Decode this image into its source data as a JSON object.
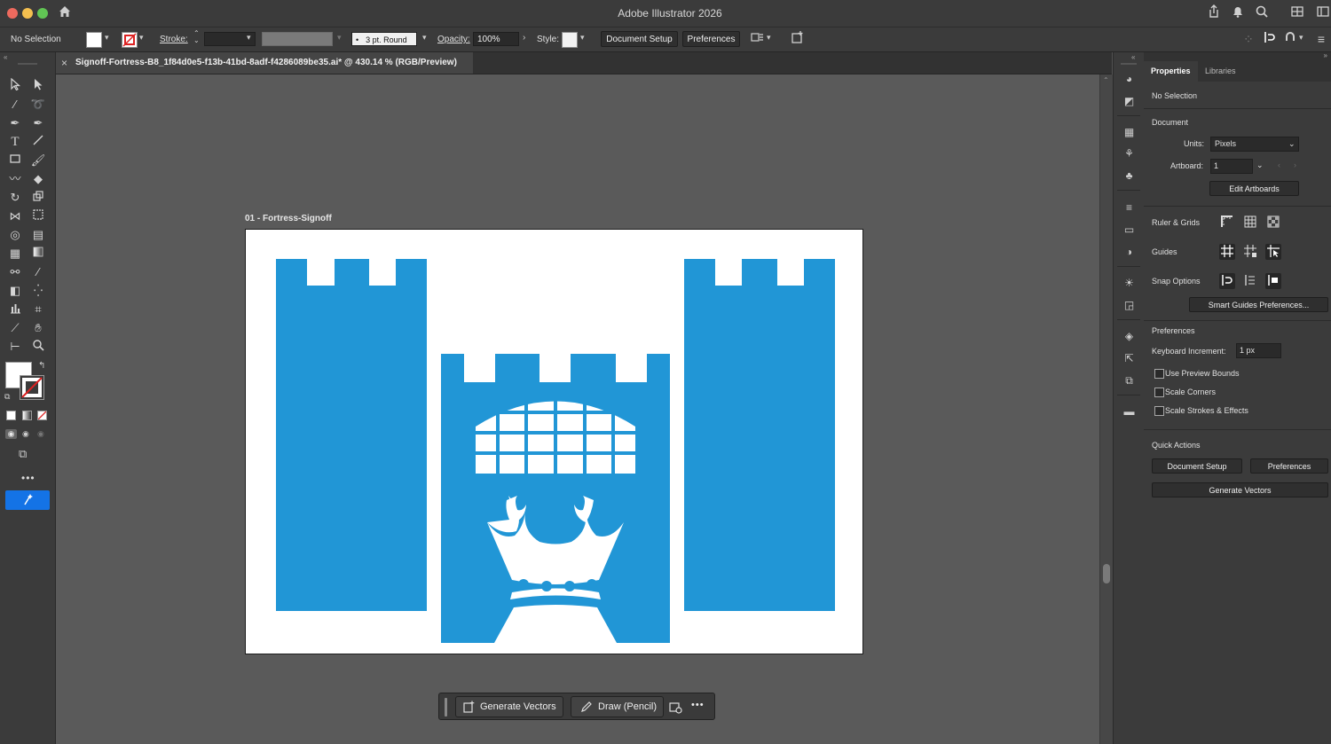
{
  "window": {
    "title": "Adobe Illustrator 2026"
  },
  "control_bar": {
    "selection_label": "No Selection",
    "stroke_label": "Stroke:",
    "brush_value": "3 pt. Round",
    "opacity_label": "Opacity:",
    "opacity_value": "100%",
    "style_label": "Style:",
    "document_setup": "Document Setup",
    "preferences": "Preferences"
  },
  "document_tab": {
    "close_glyph": "×",
    "title": "Signoff-Fortress-B8_1f84d0e5-f13b-41bd-8adf-f4286089be35.ai* @ 430.14 % (RGB/Preview)"
  },
  "artboard": {
    "label": "01 - Fortress-Signoff",
    "art_color": "#2196d6"
  },
  "context_bar": {
    "generate_vectors": "Generate Vectors",
    "draw_pencil": "Draw (Pencil)",
    "more": "•••"
  },
  "properties_panel": {
    "tabs": [
      "Properties",
      "Libraries"
    ],
    "selection": "No Selection",
    "document_heading": "Document",
    "units_label": "Units:",
    "units_value": "Pixels",
    "artboard_label": "Artboard:",
    "artboard_value": "1",
    "edit_artboards": "Edit Artboards",
    "ruler_grids": "Ruler & Grids",
    "guides": "Guides",
    "snap_options": "Snap Options",
    "smart_guides_prefs": "Smart Guides Preferences...",
    "preferences_heading": "Preferences",
    "keyboard_increment_label": "Keyboard Increment:",
    "keyboard_increment_value": "1 px",
    "use_preview_bounds": "Use Preview Bounds",
    "scale_corners": "Scale Corners",
    "scale_strokes_effects": "Scale Strokes & Effects",
    "quick_actions_heading": "Quick Actions",
    "qa_document_setup": "Document Setup",
    "qa_preferences": "Preferences",
    "qa_generate_vectors": "Generate Vectors"
  },
  "colors": {
    "accent_blue": "#1473e6",
    "traffic_red": "#ed6a5e",
    "traffic_yellow": "#f4bf4f",
    "traffic_green": "#61c554"
  }
}
